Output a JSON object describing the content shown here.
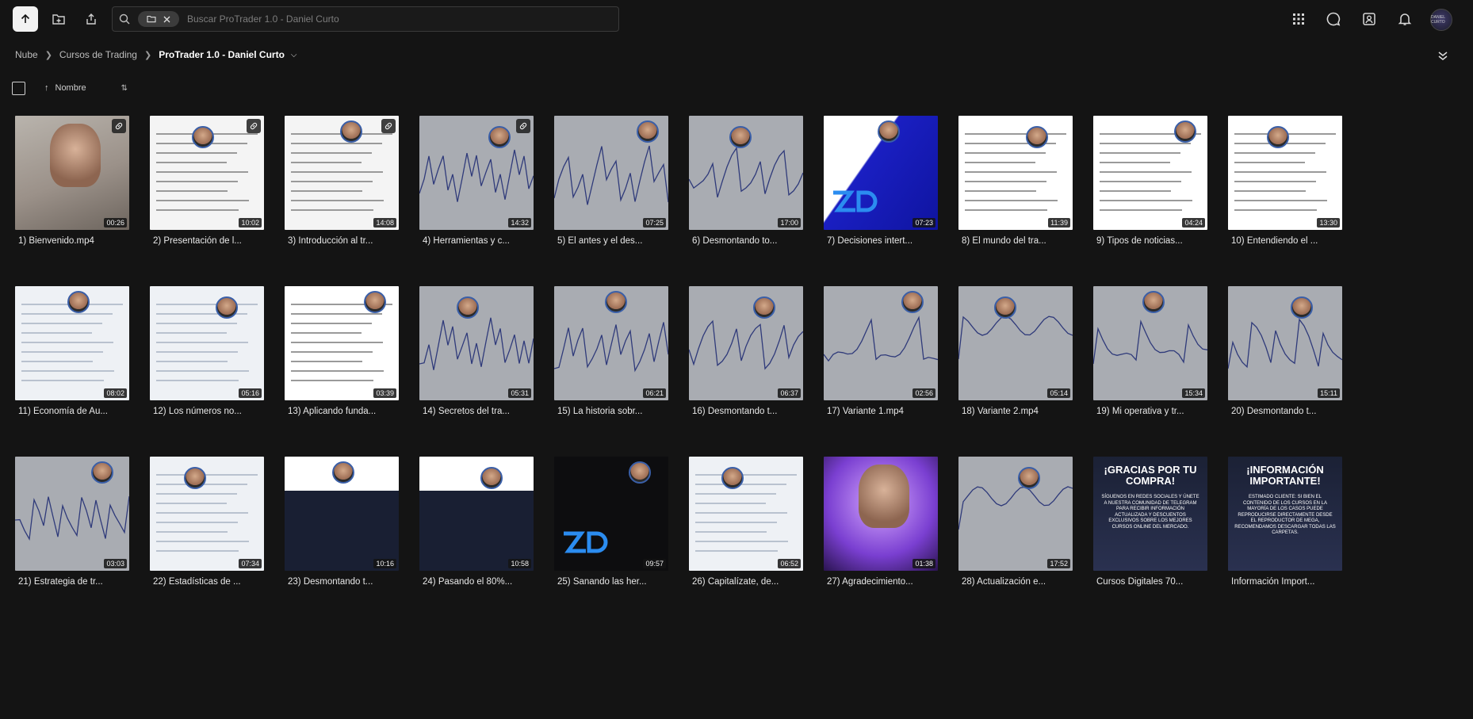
{
  "toolbar": {
    "upload_icon": "arrow-up-icon",
    "new_folder_icon": "folder-plus-icon",
    "share_icon": "share-icon"
  },
  "search": {
    "placeholder": "Buscar ProTrader 1.0 - Daniel Curto",
    "value": ""
  },
  "header_right": {
    "icons": [
      "apps-grid-icon",
      "chat-icon",
      "contacts-icon",
      "bell-icon"
    ],
    "avatar_text": "DANIEL CURTO"
  },
  "breadcrumb": {
    "items": [
      "Nube",
      "Cursos de Trading"
    ],
    "current": "ProTrader 1.0 - Daniel Curto"
  },
  "sort": {
    "label": "Nombre"
  },
  "files": [
    {
      "title": "1) Bienvenido.mp4",
      "duration": "00:26",
      "style": "t-person",
      "link": true
    },
    {
      "title": "2) Presentación de l...",
      "duration": "10:02",
      "style": "t-doc",
      "link": true
    },
    {
      "title": "3) Introducción al tr...",
      "duration": "14:08",
      "style": "t-doc",
      "link": true
    },
    {
      "title": "4) Herramientas y c...",
      "duration": "14:32",
      "style": "t-chart",
      "link": true
    },
    {
      "title": "5) El antes y el des...",
      "duration": "07:25",
      "style": "t-chart",
      "link": false
    },
    {
      "title": "6) Desmontando to...",
      "duration": "17:00",
      "style": "t-chart",
      "link": false
    },
    {
      "title": "7) Decisiones intert...",
      "duration": "07:23",
      "style": "t-brand",
      "link": false
    },
    {
      "title": "8) El mundo del tra...",
      "duration": "11:39",
      "style": "t-white",
      "link": false
    },
    {
      "title": "9) Tipos de noticias...",
      "duration": "04:24",
      "style": "t-white",
      "link": false
    },
    {
      "title": "10) Entendiendo el ...",
      "duration": "13:30",
      "style": "t-white",
      "link": false
    },
    {
      "title": "11) Economía de Au...",
      "duration": "08:02",
      "style": "t-web",
      "link": false
    },
    {
      "title": "12) Los números no...",
      "duration": "05:16",
      "style": "t-web",
      "link": false
    },
    {
      "title": "13) Aplicando funda...",
      "duration": "03:39",
      "style": "t-white",
      "link": false
    },
    {
      "title": "14) Secretos del tra...",
      "duration": "05:31",
      "style": "t-chart",
      "link": false
    },
    {
      "title": "15) La historia sobr...",
      "duration": "06:21",
      "style": "t-chart",
      "link": false
    },
    {
      "title": "16) Desmontando t...",
      "duration": "06:37",
      "style": "t-chart",
      "link": false
    },
    {
      "title": "17) Variante 1.mp4",
      "duration": "02:56",
      "style": "t-chart",
      "link": false
    },
    {
      "title": "18) Variante 2.mp4",
      "duration": "05:14",
      "style": "t-chart",
      "link": false
    },
    {
      "title": "19) Mi operativa y tr...",
      "duration": "15:34",
      "style": "t-chart",
      "link": false
    },
    {
      "title": "20) Desmontando t...",
      "duration": "15:11",
      "style": "t-chart",
      "link": false
    },
    {
      "title": "21) Estrategia de tr...",
      "duration": "03:03",
      "style": "t-chart",
      "link": false
    },
    {
      "title": "22) Estadísticas de ...",
      "duration": "07:34",
      "style": "t-web",
      "link": false
    },
    {
      "title": "23) Desmontando t...",
      "duration": "10:16",
      "style": "t-table",
      "link": false
    },
    {
      "title": "24) Pasando el 80%...",
      "duration": "10:58",
      "style": "t-table",
      "link": false
    },
    {
      "title": "25) Sanando las her...",
      "duration": "09:57",
      "style": "t-dark",
      "link": false
    },
    {
      "title": "26) Capitalízate, de...",
      "duration": "06:52",
      "style": "t-web",
      "link": false
    },
    {
      "title": "27) Agradecimiento...",
      "duration": "01:38",
      "style": "t-purple",
      "link": false
    },
    {
      "title": "28) Actualización e...",
      "duration": "17:52",
      "style": "t-chart",
      "link": false
    },
    {
      "title": "Cursos Digitales 70...",
      "duration": "",
      "style": "t-navy",
      "link": false,
      "heading": "¡GRACIAS POR TU COMPRA!",
      "body": "SÍGUENOS EN REDES SOCIALES Y ÚNETE A NUESTRA COMUNIDAD DE TELEGRAM PARA RECIBIR INFORMACIÓN ACTUALIZADA Y DESCUENTOS EXCLUSIVOS SOBRE LOS MEJORES CURSOS ONLINE DEL MERCADO."
    },
    {
      "title": "Información Import...",
      "duration": "",
      "style": "t-navy",
      "link": false,
      "heading": "¡INFORMACIÓN IMPORTANTE!",
      "body": "ESTIMADO CLIENTE: SI BIEN EL CONTENIDO DE LOS CURSOS EN LA MAYORÍA DE LOS CASOS PUEDE REPRODUCIRSE DIRECTAMENTE DESDE EL REPRODUCTOR DE MEGA, RECOMENDAMOS DESCARGAR TODAS LAS CARPETAS."
    }
  ]
}
